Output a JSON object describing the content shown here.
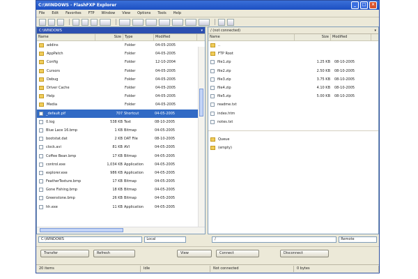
{
  "window": {
    "title": "C:\\WINDOWS - FlashFXP Explorer"
  },
  "menu": [
    "File",
    "Edit",
    "Favorites",
    "FTP",
    "Window",
    "View",
    "Options",
    "Tools",
    "Help"
  ],
  "left": {
    "path": "C:\\WINDOWS",
    "columns": [
      "Name",
      "Size",
      "Type",
      "Modified"
    ],
    "rows": [
      {
        "name": "addins",
        "size": "",
        "type": "Folder",
        "mod": "04-05-2005",
        "kind": "folder"
      },
      {
        "name": "AppPatch",
        "size": "",
        "type": "Folder",
        "mod": "04-05-2005",
        "kind": "folder"
      },
      {
        "name": "Config",
        "size": "",
        "type": "Folder",
        "mod": "12-10-2004",
        "kind": "folder"
      },
      {
        "name": "Cursors",
        "size": "",
        "type": "Folder",
        "mod": "04-05-2005",
        "kind": "folder"
      },
      {
        "name": "Debug",
        "size": "",
        "type": "Folder",
        "mod": "04-05-2005",
        "kind": "folder"
      },
      {
        "name": "Driver Cache",
        "size": "",
        "type": "Folder",
        "mod": "04-05-2005",
        "kind": "folder"
      },
      {
        "name": "Help",
        "size": "",
        "type": "Folder",
        "mod": "04-05-2005",
        "kind": "folder"
      },
      {
        "name": "Media",
        "size": "",
        "type": "Folder",
        "mod": "04-05-2005",
        "kind": "folder"
      },
      {
        "name": "_default.pif",
        "size": "707",
        "type": "Shortcut",
        "mod": "04-05-2005",
        "kind": "file"
      },
      {
        "name": "0.log",
        "size": "538 KB",
        "type": "Text",
        "mod": "08-10-2005",
        "kind": "file"
      },
      {
        "name": "Blue Lace 16.bmp",
        "size": "1 KB",
        "type": "Bitmap",
        "mod": "04-05-2005",
        "kind": "file"
      },
      {
        "name": "bootstat.dat",
        "size": "2 KB",
        "type": "DAT File",
        "mod": "08-10-2005",
        "kind": "file"
      },
      {
        "name": "clock.avi",
        "size": "81 KB",
        "type": "AVI",
        "mod": "04-05-2005",
        "kind": "file"
      },
      {
        "name": "Coffee Bean.bmp",
        "size": "17 KB",
        "type": "Bitmap",
        "mod": "04-05-2005",
        "kind": "file"
      },
      {
        "name": "control.exe",
        "size": "1,034 KB",
        "type": "Application",
        "mod": "04-05-2005",
        "kind": "file"
      },
      {
        "name": "explorer.exe",
        "size": "986 KB",
        "type": "Application",
        "mod": "04-05-2005",
        "kind": "file"
      },
      {
        "name": "FeatherTexture.bmp",
        "size": "17 KB",
        "type": "Bitmap",
        "mod": "04-05-2005",
        "kind": "file"
      },
      {
        "name": "Gone Fishing.bmp",
        "size": "18 KB",
        "type": "Bitmap",
        "mod": "04-05-2005",
        "kind": "file"
      },
      {
        "name": "Greenstone.bmp",
        "size": "26 KB",
        "type": "Bitmap",
        "mod": "04-05-2005",
        "kind": "file"
      },
      {
        "name": "hh.exe",
        "size": "11 KB",
        "type": "Application",
        "mod": "04-05-2005",
        "kind": "file"
      }
    ]
  },
  "right": {
    "path": "/ (not connected)",
    "columns": [
      "Name",
      "Size",
      "Modified"
    ],
    "rows": [
      {
        "name": "..",
        "size": "",
        "mod": "",
        "kind": "folder"
      },
      {
        "name": "FTP Root",
        "size": "",
        "mod": "",
        "kind": "folder"
      },
      {
        "name": "file1.zip",
        "size": "1.25 KB",
        "mod": "08-10-2005",
        "kind": "file"
      },
      {
        "name": "file2.zip",
        "size": "2.50 KB",
        "mod": "08-10-2005",
        "kind": "file"
      },
      {
        "name": "file3.zip",
        "size": "3.75 KB",
        "mod": "08-10-2005",
        "kind": "file"
      },
      {
        "name": "file4.zip",
        "size": "4.10 KB",
        "mod": "08-10-2005",
        "kind": "file"
      },
      {
        "name": "file5.zip",
        "size": "5.00 KB",
        "mod": "08-10-2005",
        "kind": "file"
      },
      {
        "name": "readme.txt",
        "size": "",
        "mod": "",
        "kind": "file"
      },
      {
        "name": "index.htm",
        "size": "",
        "mod": "",
        "kind": "file"
      },
      {
        "name": "notes.txt",
        "size": "",
        "mod": "",
        "kind": "file"
      }
    ],
    "queue_rows": [
      {
        "name": "Queue",
        "kind": "folder"
      },
      {
        "name": "(empty)",
        "kind": "folder"
      }
    ]
  },
  "addr": {
    "left": "C:\\WINDOWS",
    "left_drop": "Local",
    "right": "/",
    "right_drop": "Remote"
  },
  "buttons": {
    "b1": "Transfer",
    "b2": "Refresh",
    "b3": "View",
    "b4": "Connect",
    "b5": "Disconnect"
  },
  "status": {
    "s1": "20 items",
    "s2": "Idle",
    "s3": "Not connected",
    "s4": "0 bytes"
  }
}
